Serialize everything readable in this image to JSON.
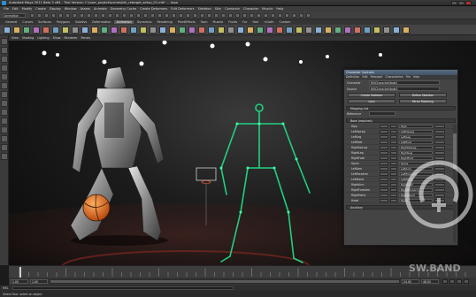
{
  "window": {
    "title": "Autodesk Maya 2011 Beta 3 x64 - Trial Version: C:\\user_project\\scenes\\hik_retarget_setup_01.mb* --- topo"
  },
  "menubar": [
    "File",
    "Edit",
    "Modify",
    "Create",
    "Display",
    "Window",
    "Assets",
    "Animate",
    "Geometry Cache",
    "Create Deformers",
    "Edit Deformers",
    "Skeleton",
    "Skin",
    "Constrain",
    "Character",
    "Muscle",
    "Help"
  ],
  "statusline": {
    "mode": "Animation"
  },
  "shelf_tabs": [
    "General",
    "Curves",
    "Surfaces",
    "Polygons",
    "Subdivs",
    "Deformation",
    "Animation",
    "Dynamics",
    "Rendering",
    "PaintEffects",
    "Toon",
    "Muscle",
    "Fluids",
    "Fur",
    "Hair",
    "nCloth",
    "Custom"
  ],
  "shelf_active": "Animation",
  "viewport": {
    "menu": [
      "View",
      "Shading",
      "Lighting",
      "Show",
      "Renderer",
      "Panels"
    ]
  },
  "panel": {
    "title": "Character Controls",
    "tabs": [
      "Definition",
      "Edit",
      "Retarget",
      "Characterize",
      "File",
      "Help"
    ],
    "name_label": "Character",
    "name_value": "HIKCharacterNode1",
    "source_label": "Source",
    "source_value": "HIKCharacterNode2",
    "buttons": [
      "Create Skeleton",
      "Define Skeleton",
      "Lock",
      "Mirror Matching"
    ],
    "section_label": "Mapping List",
    "filter_label": "Reference",
    "group_label": "Base (required)",
    "rows": [
      {
        "name": "Hips",
        "bone": "Hips"
      },
      {
        "name": "LeftUpLeg",
        "bone": "LeftUpLeg"
      },
      {
        "name": "LeftLeg",
        "bone": "LeftLeg"
      },
      {
        "name": "LeftFoot",
        "bone": "LeftFoot"
      },
      {
        "name": "RightUpLeg",
        "bone": "RightUpLeg"
      },
      {
        "name": "RightLeg",
        "bone": "RightLeg"
      },
      {
        "name": "RightFoot",
        "bone": "RightFoot"
      },
      {
        "name": "Spine",
        "bone": "Spine"
      },
      {
        "name": "LeftArm",
        "bone": "LeftArm"
      },
      {
        "name": "LeftForeArm",
        "bone": "LeftForeArm"
      },
      {
        "name": "LeftHand",
        "bone": "LeftHand"
      },
      {
        "name": "RightArm",
        "bone": "RightArm"
      },
      {
        "name": "RightForeArm",
        "bone": "RightForeArm"
      },
      {
        "name": "RightHand",
        "bone": "RightHand"
      },
      {
        "name": "Head",
        "bone": "Head"
      }
    ],
    "section2_label": "Auxiliary"
  },
  "timeline": {
    "start": "1.00",
    "end": "24.00",
    "range_start": "1.00",
    "range_end": "48.00"
  },
  "cmdline": {
    "label": "MEL"
  },
  "helpline": {
    "text": "Select Tool: select an object"
  },
  "watermark": {
    "text": "SW.BAND"
  }
}
